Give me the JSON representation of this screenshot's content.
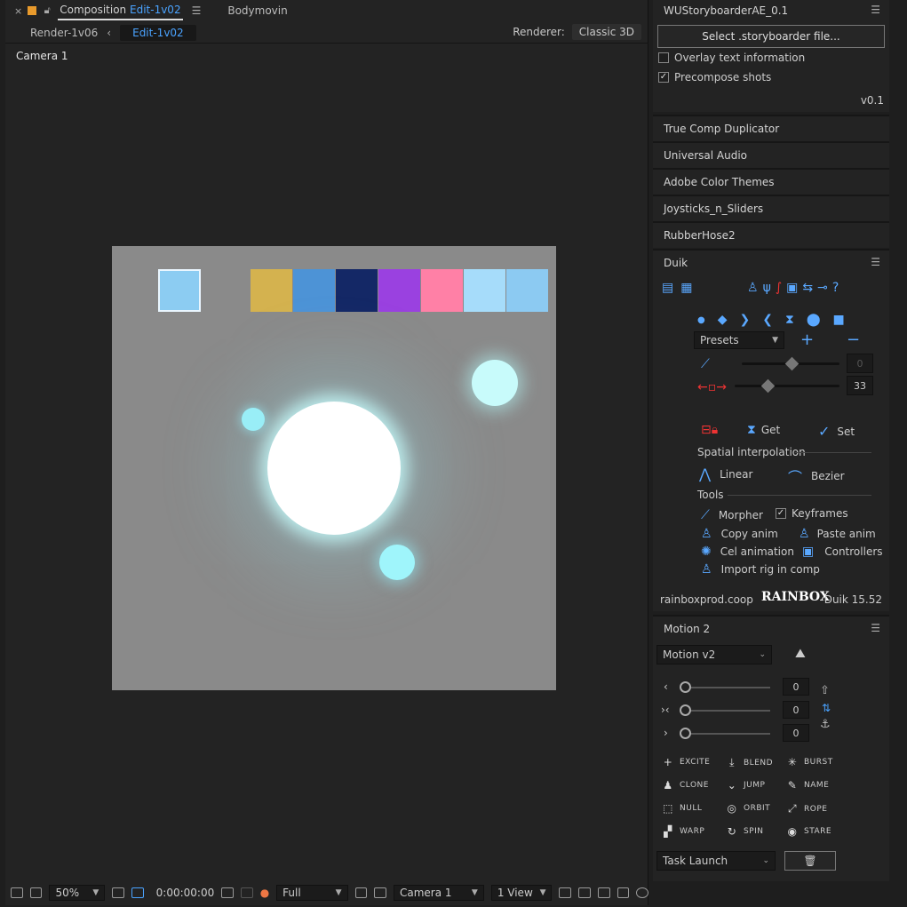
{
  "comp_panel": {
    "tab_prefix": "Composition",
    "tab_name": "Edit-1v02",
    "other_tab": "Bodymovin",
    "flow_prev": "Render-1v06",
    "flow_current": "Edit-1v02",
    "renderer_label": "Renderer:",
    "renderer_value": "Classic 3D",
    "view_label": "Camera 1"
  },
  "canvas": {
    "swatches": [
      {
        "color": "#8cccf2"
      },
      {
        "color": "#d4b24f"
      },
      {
        "color": "#4d93d6"
      },
      {
        "color": "#142866"
      },
      {
        "color": "#9a41e0"
      },
      {
        "color": "#ff80a6"
      },
      {
        "color": "#a6dcfa"
      },
      {
        "color": "#8ccaf2"
      }
    ]
  },
  "viewer_bar": {
    "zoom": "50%",
    "timecode": "0:00:00:00",
    "resolution": "Full",
    "camera": "Camera 1",
    "views": "1 View"
  },
  "storyboarder": {
    "title": "WUStoryboarderAE_0.1",
    "select_button": "Select .storyboarder file...",
    "overlay_label": "Overlay text information",
    "overlay_checked": false,
    "precompose_label": "Precompose shots",
    "precompose_checked": true,
    "version": "v0.1"
  },
  "collapsed_panels": [
    "True Comp Duplicator",
    "Universal Audio",
    "Adobe Color Themes",
    "Joysticks_n_Sliders",
    "RubberHose2"
  ],
  "duik": {
    "title": "Duik",
    "presets": "Presets",
    "slider1_value": "0",
    "slider2_value": "33",
    "get_label": "Get",
    "set_label": "Set",
    "spatial_label": "Spatial interpolation",
    "linear_label": "Linear",
    "bezier_label": "Bezier",
    "tools_label": "Tools",
    "morpher_label": "Morpher",
    "keyframes_label": "Keyframes",
    "copy_anim_label": "Copy anim",
    "paste_anim_label": "Paste anim",
    "cel_animation_label": "Cel animation",
    "controllers_label": "Controllers",
    "import_rig_label": "Import rig in comp",
    "footer_link": "rainboxprod.coop",
    "footer_logo": "RAINBOX",
    "footer_version": "Duik 15.52"
  },
  "motion2": {
    "title": "Motion 2",
    "preset": "Motion v2",
    "slider_values": [
      "0",
      "0",
      "0"
    ],
    "buttons": [
      "EXCITE",
      "BLEND",
      "BURST",
      "CLONE",
      "JUMP",
      "NAME",
      "NULL",
      "ORBIT",
      "ROPE",
      "WARP",
      "SPIN",
      "STARE"
    ],
    "task_select": "Task Launch"
  }
}
